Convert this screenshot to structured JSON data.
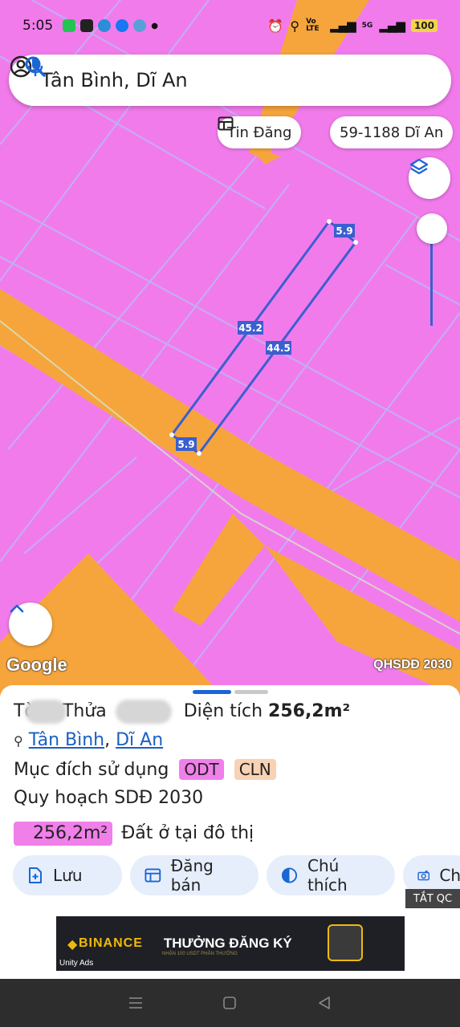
{
  "status_bar": {
    "time": "5:05",
    "network_label": "Vo LTE",
    "network_type": "5G",
    "battery": "100"
  },
  "search": {
    "query": "Tân Bình, Dĩ An"
  },
  "chips": {
    "listing_label": "Tin Đăng",
    "plate_label": "59-1188 Dĩ An"
  },
  "map": {
    "measurements": [
      "5.9",
      "45.2",
      "44.5",
      "5.9"
    ],
    "attribution": "Google",
    "layer_name": "QHSDĐ 2030"
  },
  "parcel": {
    "to_label": "Tờ",
    "thua_label": "Thửa",
    "area_label": "Diện tích",
    "area_value": "256,2m²",
    "ward": "Tân Bình",
    "separator": ",",
    "city": "Dĩ An",
    "purpose_label": "Mục đích sử dụng",
    "purpose_codes": [
      "ODT",
      "CLN"
    ],
    "plan_label": "Quy hoạch SDĐ 2030",
    "plan_area": "256,2m²",
    "plan_desc": "Đất ở tại đô thị"
  },
  "actions": {
    "save": "Lưu",
    "sell": "Đăng bán",
    "legend": "Chú thích",
    "photo": "Ch"
  },
  "ad": {
    "close_label": "TẮT QC",
    "brand": "BINANCE",
    "cta": "THƯỞNG ĐĂNG KÝ",
    "sub": "NHẬN 100 USDT PHẦN THƯỞNG",
    "network": "Unity Ads"
  },
  "colors": {
    "residential": "#f27bec",
    "road": "#f6a53c",
    "measure_line": "#3a5fcf",
    "odt_tag": "#f07fe9",
    "cln_tag": "#f8d2b4"
  }
}
